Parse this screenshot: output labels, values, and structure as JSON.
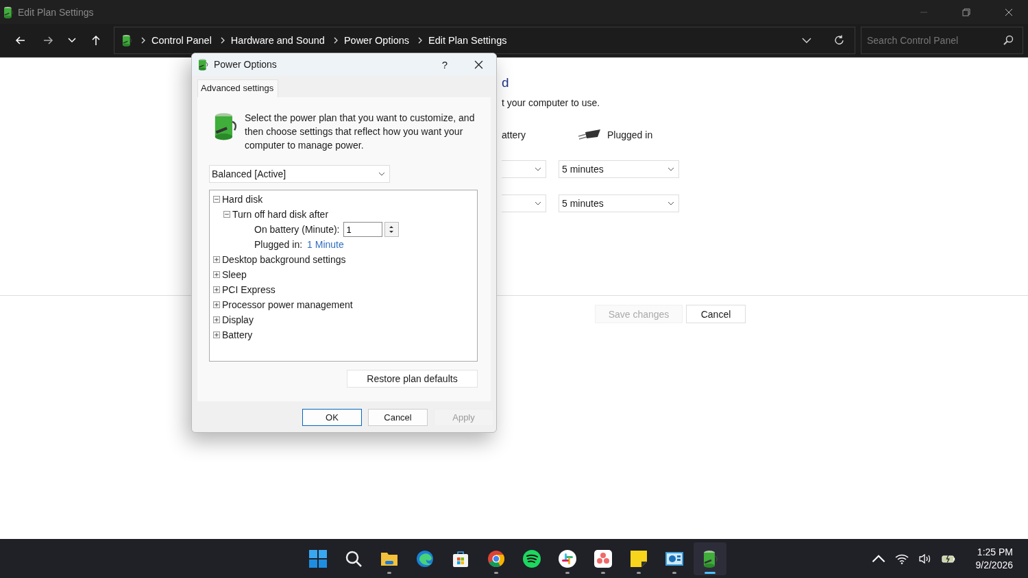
{
  "window": {
    "title": "Edit Plan Settings"
  },
  "nav": {
    "breadcrumb": [
      "Control Panel",
      "Hardware and Sound",
      "Power Options",
      "Edit Plan Settings"
    ],
    "search": {
      "placeholder": "Search Control Panel"
    }
  },
  "page": {
    "heading": "d",
    "description": "t your computer to use.",
    "columns": [
      {
        "kind": "battery",
        "label": "attery"
      },
      {
        "kind": "plug",
        "label": "Plugged in"
      }
    ],
    "rows": [
      {
        "plugged_in": "5 minutes"
      },
      {
        "plugged_in": "5 minutes"
      }
    ],
    "buttons": [
      {
        "label": "Save changes",
        "disabled": true
      },
      {
        "label": "Cancel",
        "disabled": false
      }
    ]
  },
  "dialog": {
    "title": "Power Options",
    "help": "?",
    "tabs": [
      {
        "label": "Advanced settings",
        "selected": true
      }
    ],
    "description": "Select the power plan that you want to customize, and then choose settings that reflect how you want your computer to manage power.",
    "plan": "Balanced [Active]",
    "tree": [
      {
        "kind": "group",
        "label": "Hard disk",
        "expanded": true,
        "children": [
          {
            "kind": "group",
            "label": "Turn off hard disk after",
            "expanded": true,
            "children": [
              {
                "kind": "spin",
                "label": "On battery (Minute):",
                "value": "1"
              },
              {
                "kind": "link",
                "label": "Plugged in:",
                "value": "1 Minute"
              }
            ]
          }
        ]
      },
      {
        "kind": "group",
        "label": "Desktop background settings",
        "expanded": false
      },
      {
        "kind": "group",
        "label": "Sleep",
        "expanded": false
      },
      {
        "kind": "group",
        "label": "PCI Express",
        "expanded": false
      },
      {
        "kind": "group",
        "label": "Processor power management",
        "expanded": false
      },
      {
        "kind": "group",
        "label": "Display",
        "expanded": false
      },
      {
        "kind": "group",
        "label": "Battery",
        "expanded": false
      }
    ],
    "restore": "Restore plan defaults",
    "buttons": [
      {
        "label": "OK",
        "default": true,
        "disabled": false
      },
      {
        "label": "Cancel",
        "default": false,
        "disabled": false
      },
      {
        "label": "Apply",
        "default": false,
        "disabled": true
      }
    ]
  },
  "taskbar": {
    "apps": [
      {
        "kind": "windows",
        "running": false,
        "selected": false
      },
      {
        "kind": "search",
        "running": false,
        "selected": false
      },
      {
        "kind": "folder",
        "running": true,
        "selected": false
      },
      {
        "kind": "edge",
        "running": false,
        "selected": false
      },
      {
        "kind": "store",
        "running": false,
        "selected": false
      },
      {
        "kind": "chrome",
        "running": true,
        "selected": false
      },
      {
        "kind": "spotify",
        "running": false,
        "selected": false
      },
      {
        "kind": "slack",
        "running": true,
        "selected": false
      },
      {
        "kind": "asana",
        "running": true,
        "selected": false
      },
      {
        "kind": "sticky",
        "running": true,
        "selected": false
      },
      {
        "kind": "panel",
        "running": true,
        "selected": false
      },
      {
        "kind": "power",
        "running": true,
        "selected": true
      }
    ],
    "clock": {
      "time": "1:25 PM",
      "date": "9/2/2026"
    }
  }
}
